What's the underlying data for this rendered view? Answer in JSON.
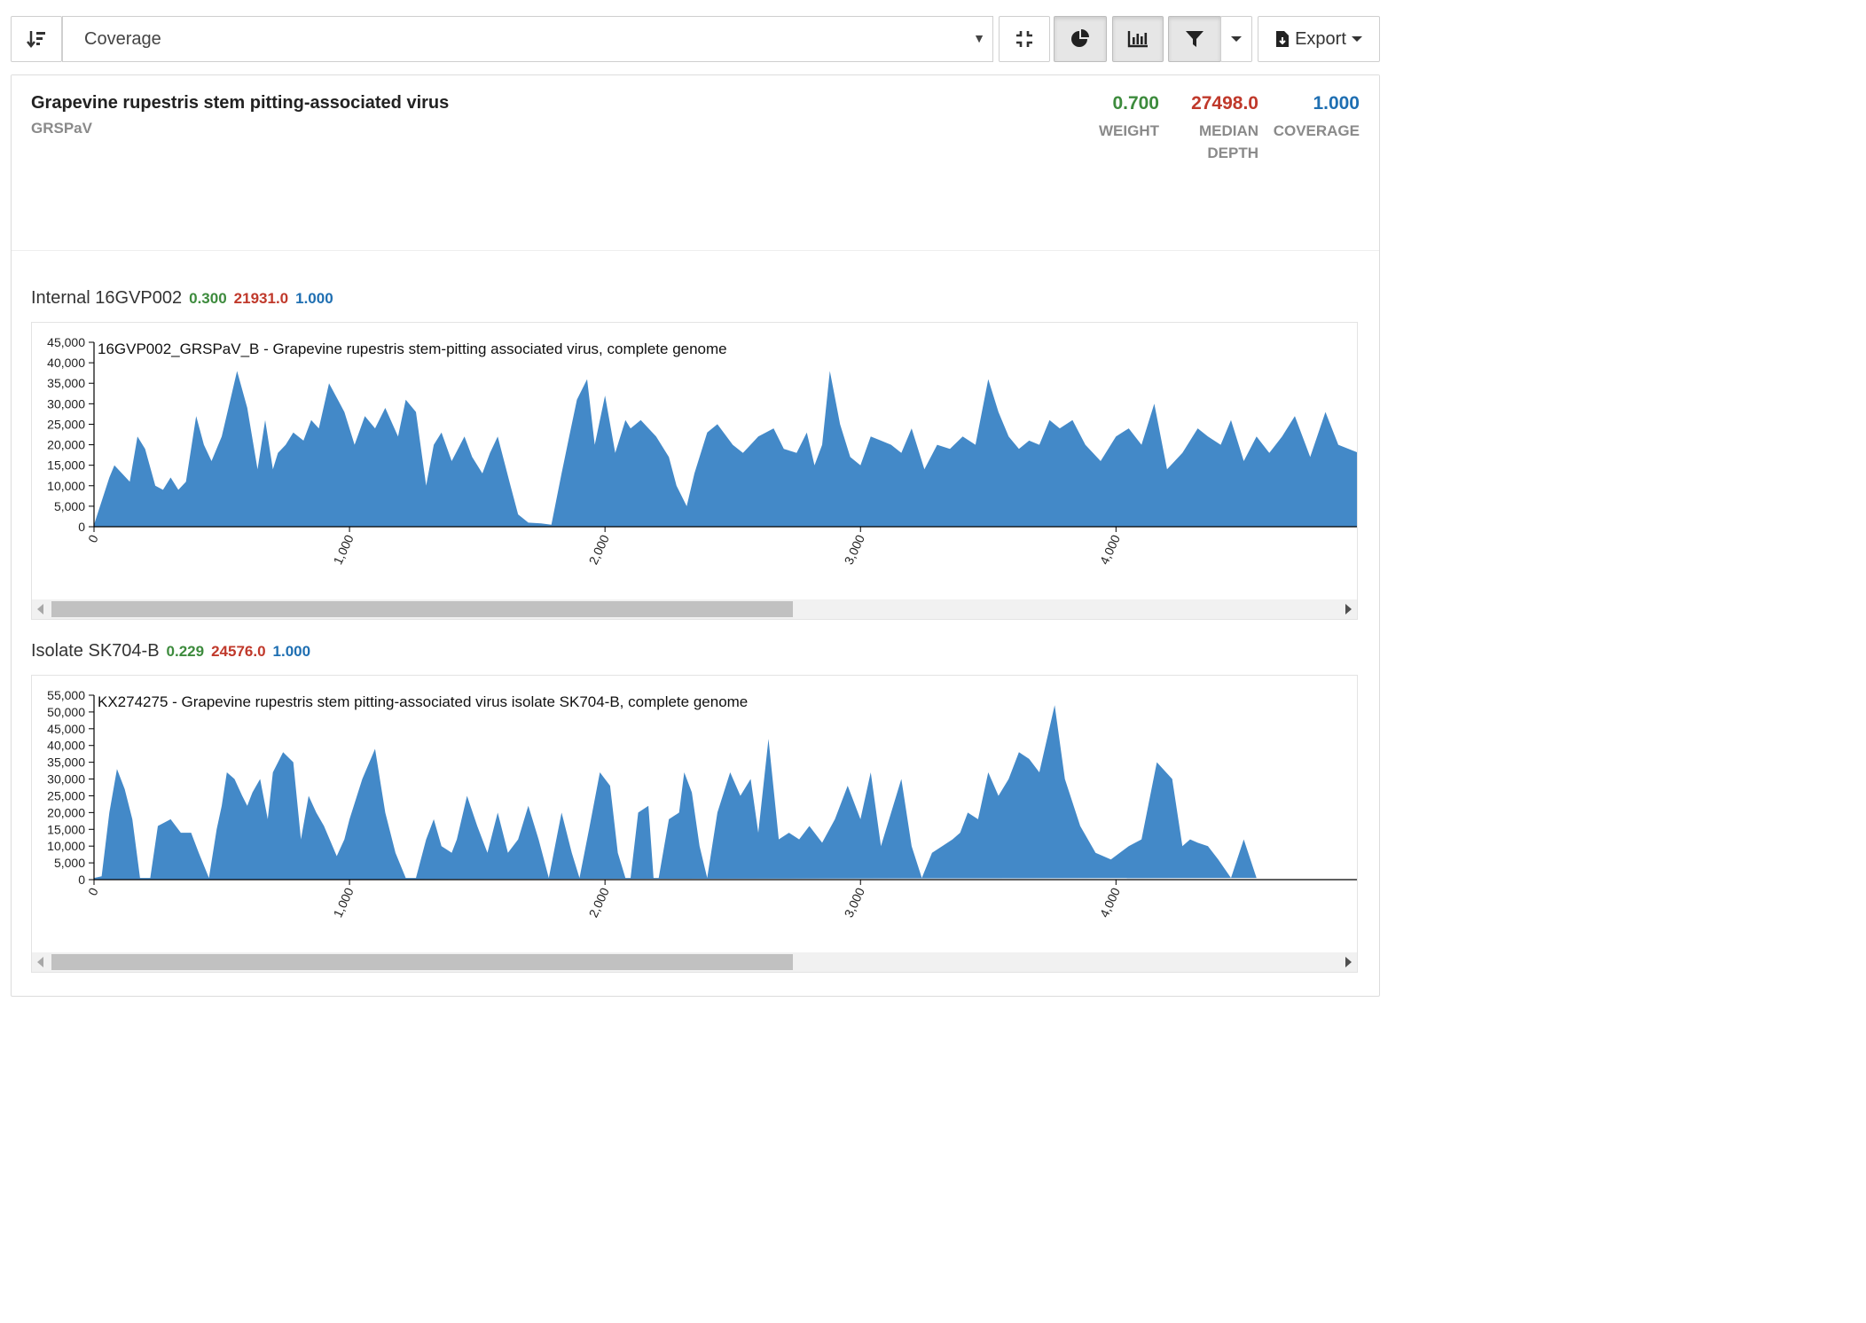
{
  "toolbar": {
    "sort_icon": "sort-descending-icon",
    "select_value": "Coverage",
    "collapse_icon": "collapse-icon",
    "pie_icon": "pie-chart-icon",
    "bars_icon": "bar-chart-icon",
    "filter_icon": "filter-icon",
    "export_icon": "file-export-icon",
    "export_label": "Export"
  },
  "summary": {
    "name": "Grapevine rupestris stem pitting-associated virus",
    "abbreviation": "GRSPaV",
    "weight": "0.700",
    "weight_label": "WEIGHT",
    "median_depth": "27498.0",
    "median_depth_label": "MEDIAN DEPTH",
    "coverage": "1.000",
    "coverage_label": "COVERAGE"
  },
  "colors": {
    "fill": "#4389c8",
    "weight": "#3d8b3d",
    "depth": "#c0392b",
    "coverage": "#1f6fb2"
  },
  "isolates": [
    {
      "name": "Internal 16GVP002",
      "weight": "0.300",
      "median_depth": "21931.0",
      "coverage": "1.000"
    },
    {
      "name": "Isolate SK704-B",
      "weight": "0.229",
      "median_depth": "24576.0",
      "coverage": "1.000"
    }
  ],
  "chart_data": [
    {
      "type": "area",
      "title": "16GVP002_GRSPaV_B - Grapevine rupestris stem-pitting associated virus, complete genome",
      "ylim": [
        0,
        45000
      ],
      "y_ticks": [
        "0",
        "5,000",
        "10,000",
        "15,000",
        "20,000",
        "25,000",
        "30,000",
        "35,000",
        "40,000",
        "45,000"
      ],
      "x_ticks": [
        "0",
        "1,000",
        "2,000",
        "3,000",
        "4,000"
      ],
      "xlim_visible": [
        0,
        4950
      ],
      "x": [
        0,
        60,
        80,
        140,
        170,
        200,
        240,
        270,
        300,
        330,
        360,
        400,
        430,
        460,
        500,
        530,
        560,
        600,
        640,
        670,
        700,
        720,
        750,
        780,
        820,
        850,
        880,
        920,
        980,
        1020,
        1060,
        1100,
        1140,
        1190,
        1220,
        1260,
        1300,
        1330,
        1360,
        1400,
        1450,
        1480,
        1520,
        1550,
        1580,
        1630,
        1660,
        1700,
        1750,
        1790,
        1830,
        1860,
        1890,
        1930,
        1960,
        2000,
        2040,
        2080,
        2100,
        2140,
        2200,
        2250,
        2280,
        2320,
        2350,
        2400,
        2440,
        2500,
        2540,
        2600,
        2660,
        2700,
        2750,
        2790,
        2820,
        2850,
        2880,
        2920,
        2960,
        3000,
        3040,
        3080,
        3120,
        3160,
        3200,
        3250,
        3300,
        3350,
        3400,
        3450,
        3500,
        3540,
        3580,
        3620,
        3660,
        3700,
        3740,
        3780,
        3830,
        3880,
        3940,
        4000,
        4050,
        4100,
        4150,
        4200,
        4260,
        4320,
        4360,
        4410,
        4450,
        4500,
        4550,
        4600,
        4650,
        4700,
        4760,
        4820,
        4870,
        4950
      ],
      "values": [
        500,
        12000,
        15000,
        11000,
        22000,
        19000,
        10000,
        9000,
        12000,
        9000,
        11000,
        27000,
        20000,
        16000,
        22000,
        30000,
        38000,
        29000,
        14000,
        26000,
        14000,
        18000,
        20000,
        23000,
        21000,
        26000,
        24000,
        35000,
        28000,
        20000,
        27000,
        24000,
        29000,
        22000,
        31000,
        28000,
        10000,
        20000,
        23000,
        16000,
        22000,
        17000,
        13000,
        18000,
        22000,
        10000,
        3000,
        1000,
        800,
        500,
        13000,
        22000,
        31000,
        36000,
        20000,
        32000,
        18000,
        26000,
        24000,
        26000,
        22000,
        17000,
        10000,
        5000,
        13000,
        23000,
        25000,
        20000,
        18000,
        22000,
        24000,
        19000,
        18000,
        23000,
        15000,
        20000,
        38000,
        25000,
        17000,
        15000,
        22000,
        21000,
        20000,
        18000,
        24000,
        14000,
        20000,
        19000,
        22000,
        20000,
        36000,
        28000,
        22000,
        19000,
        21000,
        20000,
        26000,
        24000,
        26000,
        20000,
        16000,
        22000,
        24000,
        20000,
        30000,
        14000,
        18000,
        24000,
        22000,
        20000,
        26000,
        16000,
        22000,
        18000,
        22000,
        27000,
        17000,
        28000,
        20000,
        18000
      ]
    },
    {
      "type": "area",
      "title": "KX274275 - Grapevine rupestris stem pitting-associated virus isolate SK704-B, complete genome",
      "ylim": [
        0,
        55000
      ],
      "y_ticks": [
        "0",
        "5,000",
        "10,000",
        "15,000",
        "20,000",
        "25,000",
        "30,000",
        "35,000",
        "40,000",
        "45,000",
        "50,000",
        "55,000"
      ],
      "x_ticks": [
        "0",
        "1,000",
        "2,000",
        "3,000",
        "4,000"
      ],
      "xlim_visible": [
        0,
        4950
      ],
      "x": [
        0,
        30,
        60,
        90,
        120,
        150,
        180,
        220,
        250,
        300,
        340,
        380,
        410,
        450,
        480,
        500,
        520,
        550,
        580,
        600,
        620,
        650,
        680,
        700,
        740,
        780,
        810,
        840,
        870,
        900,
        950,
        980,
        1000,
        1050,
        1100,
        1140,
        1180,
        1220,
        1260,
        1300,
        1330,
        1360,
        1400,
        1420,
        1460,
        1500,
        1540,
        1580,
        1620,
        1660,
        1700,
        1740,
        1780,
        1830,
        1870,
        1900,
        1940,
        1980,
        2020,
        2050,
        2080,
        2100,
        2130,
        2170,
        2190,
        2210,
        2250,
        2290,
        2310,
        2340,
        2370,
        2400,
        2440,
        2490,
        2530,
        2570,
        2600,
        2640,
        2680,
        2720,
        2760,
        2800,
        2850,
        2900,
        2950,
        3000,
        3040,
        3080,
        3120,
        3160,
        3200,
        3240,
        3280,
        3320,
        3360,
        3390,
        3420,
        3460,
        3500,
        3540,
        3580,
        3620,
        3660,
        3700,
        3760,
        3800,
        3860,
        3920,
        3980,
        4050,
        4100,
        4160,
        4220,
        4260,
        4290,
        4320,
        4360,
        4400,
        4450,
        4500,
        4550,
        4600,
        4650,
        4700,
        4750,
        4800,
        4840,
        4880,
        4920,
        4950
      ],
      "values": [
        500,
        1000,
        20000,
        33000,
        27000,
        18000,
        500,
        500,
        16000,
        18000,
        14000,
        14000,
        8000,
        500,
        15000,
        22000,
        32000,
        30000,
        25000,
        22000,
        26000,
        30000,
        18000,
        32000,
        38000,
        35000,
        12000,
        25000,
        20000,
        16000,
        7000,
        12000,
        18000,
        30000,
        39000,
        20000,
        8000,
        500,
        500,
        12000,
        18000,
        10000,
        8000,
        12000,
        25000,
        16000,
        8000,
        20000,
        8000,
        12000,
        22000,
        12000,
        500,
        20000,
        8000,
        500,
        16000,
        32000,
        28000,
        8000,
        500,
        500,
        20000,
        22000,
        500,
        500,
        18000,
        20000,
        32000,
        26000,
        10000,
        500,
        20000,
        32000,
        25000,
        30000,
        14000,
        42000,
        12000,
        14000,
        12000,
        16000,
        11000,
        18000,
        28000,
        18000,
        32000,
        10000,
        20000,
        30000,
        10000,
        500,
        8000,
        10000,
        12000,
        14000,
        20000,
        18000,
        32000,
        25000,
        30000,
        38000,
        36000,
        32000,
        52000,
        30000,
        16000,
        8000,
        6000,
        10000,
        12000,
        35000,
        30000,
        10000,
        12000,
        11000,
        10000,
        6000,
        500,
        12000,
        500
      ]
    }
  ]
}
